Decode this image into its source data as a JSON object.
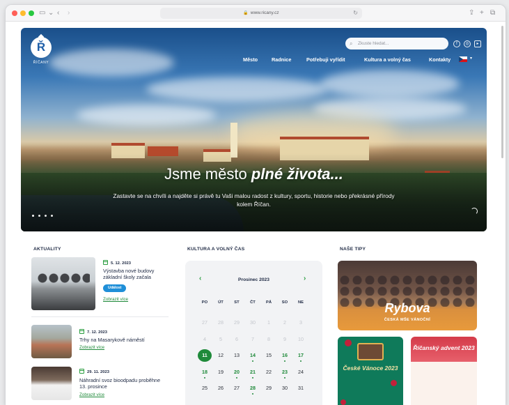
{
  "browser": {
    "url": "www.ricany.cz"
  },
  "header": {
    "logo_letter": "Ř",
    "logo_text": "ŘÍČANY",
    "search_placeholder": "Zkuste hledat...",
    "nav": [
      "Město",
      "Radnice",
      "Potřebuji vyřídit",
      "Kultura a volný čas",
      "Kontakty"
    ]
  },
  "hero": {
    "title_plain": "Jsme město ",
    "title_emphasis": "plné života...",
    "subtitle": "Zastavte se na chvíli a najděte si právě tu Vaši malou radost z kultury, sportu, historie nebo překrásné přírody kolem Říčan."
  },
  "news": {
    "heading": "AKTUALITY",
    "items": [
      {
        "date": "5. 12. 2023",
        "title": "Výstavba nové budovy základní školy začala",
        "tag": "Událost",
        "more": "Zobrazit více"
      },
      {
        "date": "7. 12. 2023",
        "title": "Trhy na Masarykově náměstí",
        "more": "Zobrazit více"
      },
      {
        "date": "29. 11. 2023",
        "title": "Náhradní svoz bioodpadu proběhne 13. prosince",
        "more": "Zobrazit více"
      }
    ]
  },
  "calendar": {
    "heading": "KULTURA A VOLNÝ ČAS",
    "month": "Prosinec 2023",
    "weekdays": [
      "PO",
      "ÚT",
      "ST",
      "ČT",
      "PÁ",
      "SO",
      "NE"
    ],
    "rows": [
      [
        "27",
        "28",
        "29",
        "30",
        "1",
        "2",
        "3"
      ],
      [
        "4",
        "5",
        "6",
        "7",
        "8",
        "9",
        "10"
      ],
      [
        "11",
        "12",
        "13",
        "14",
        "15",
        "16",
        "17"
      ],
      [
        "18",
        "19",
        "20",
        "21",
        "22",
        "23",
        "24"
      ],
      [
        "25",
        "26",
        "27",
        "28",
        "29",
        "30",
        "31"
      ]
    ],
    "muted": [
      [
        0,
        0
      ],
      [
        0,
        1
      ],
      [
        0,
        2
      ],
      [
        0,
        3
      ],
      [
        0,
        4
      ],
      [
        0,
        5
      ],
      [
        0,
        6
      ],
      [
        1,
        0
      ],
      [
        1,
        1
      ],
      [
        1,
        2
      ],
      [
        1,
        3
      ],
      [
        1,
        4
      ],
      [
        1,
        5
      ],
      [
        1,
        6
      ]
    ],
    "today": [
      2,
      0
    ],
    "events": [
      [
        2,
        3
      ],
      [
        2,
        5
      ],
      [
        2,
        6
      ],
      [
        3,
        0
      ],
      [
        3,
        2
      ],
      [
        3,
        3
      ],
      [
        3,
        5
      ],
      [
        4,
        3
      ]
    ]
  },
  "tips": {
    "heading": "NAŠE TIPY",
    "big_title": "Rybova",
    "big_subtitle": "ČESKÁ MŠE VÁNOČNÍ",
    "green_title": "České Vánoce 2023",
    "light_title": "Říčanský advent 2023"
  },
  "colors": {
    "accent_green": "#1f8a3a",
    "brand_blue": "#1f5fa8",
    "tag_blue": "#1f8fd8"
  }
}
